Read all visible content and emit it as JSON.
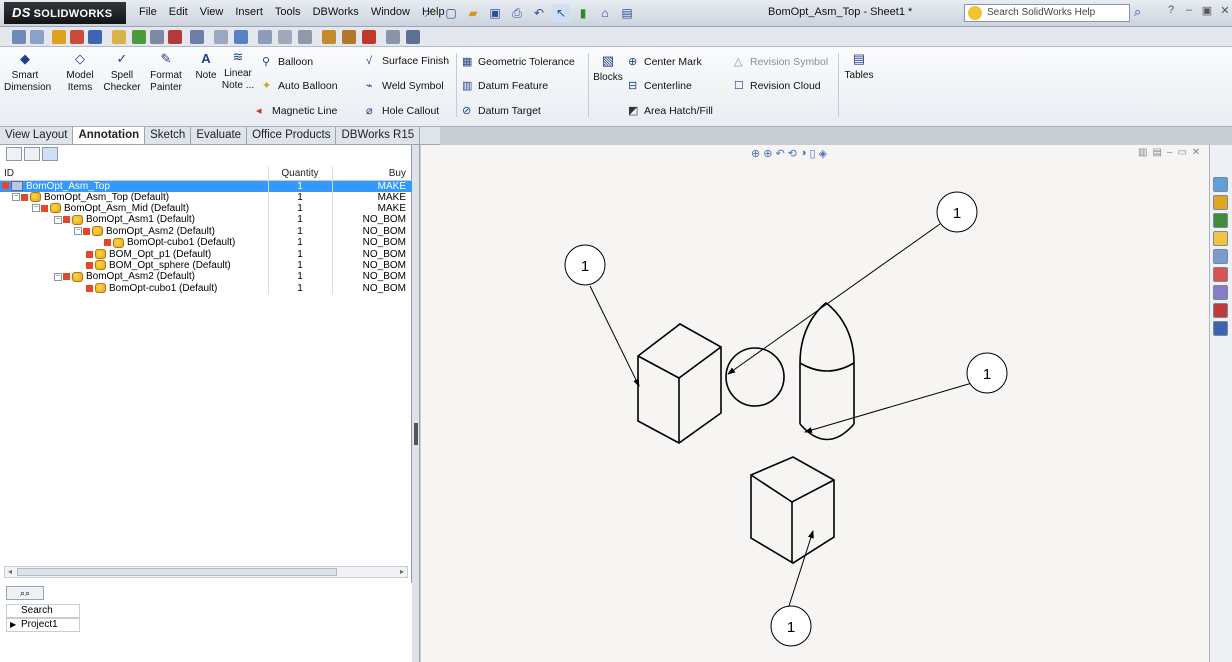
{
  "app": {
    "logo_text": "SOLIDWORKS",
    "logo_prefix": "DS",
    "document_title": "BomOpt_Asm_Top - Sheet1 *",
    "help_search_placeholder": "Search SolidWorks Help",
    "menus": [
      "File",
      "Edit",
      "View",
      "Insert",
      "Tools",
      "DBWorks",
      "Window",
      "Help"
    ]
  },
  "ribbon": {
    "smart_dimension": "Smart Dimension",
    "model_items": "Model Items",
    "spell_checker": "Spell Checker",
    "format_painter": "Format Painter",
    "note": "Note",
    "linear_note": "Linear Note ...",
    "balloon": "Balloon",
    "auto_balloon": "Auto Balloon",
    "magnetic_line": "Magnetic Line",
    "surface_finish": "Surface Finish",
    "weld_symbol": "Weld Symbol",
    "hole_callout": "Hole Callout",
    "geometric_tolerance": "Geometric Tolerance",
    "datum_feature": "Datum Feature",
    "datum_target": "Datum Target",
    "blocks": "Blocks",
    "center_mark": "Center Mark",
    "centerline": "Centerline",
    "area_hatch": "Area Hatch/Fill",
    "revision_symbol": "Revision Symbol",
    "revision_cloud": "Revision Cloud",
    "tables": "Tables"
  },
  "command_tabs": [
    "View Layout",
    "Annotation",
    "Sketch",
    "Evaluate",
    "Office Products",
    "DBWorks R15"
  ],
  "active_tab": "Annotation",
  "bom": {
    "headers": {
      "id": "ID",
      "quantity": "Quantity",
      "buy": "Buy"
    },
    "rows": [
      {
        "name": "BomOpt_Asm_Top",
        "quantity": "1",
        "buy": "MAKE"
      },
      {
        "name": "BomOpt_Asm_Top (Default)",
        "quantity": "1",
        "buy": "MAKE"
      },
      {
        "name": "BomOpt_Asm_Mid (Default)",
        "quantity": "1",
        "buy": "MAKE"
      },
      {
        "name": "BomOpt_Asm1 (Default)",
        "quantity": "1",
        "buy": "NO_BOM"
      },
      {
        "name": "BomOpt_Asm2 (Default)",
        "quantity": "1",
        "buy": "NO_BOM"
      },
      {
        "name": "BomOpt-cubo1 (Default)",
        "quantity": "1",
        "buy": "NO_BOM"
      },
      {
        "name": "BOM_Opt_p1 (Default)",
        "quantity": "1",
        "buy": "NO_BOM"
      },
      {
        "name": "BOM_Opt_sphere (Default)",
        "quantity": "1",
        "buy": "NO_BOM"
      },
      {
        "name": "BomOpt_Asm2 (Default)",
        "quantity": "1",
        "buy": "NO_BOM"
      },
      {
        "name": "BomOpt-cubo1 (Default)",
        "quantity": "1",
        "buy": "NO_BOM"
      }
    ]
  },
  "search_panel": {
    "search_label": "Search",
    "project": "Project1"
  },
  "drawing": {
    "balloons": [
      "1",
      "1",
      "1",
      "1"
    ]
  },
  "colors": {
    "selection": "#3399ff",
    "ribbon_icon": "#203f86",
    "sheet": "#f6f5f3"
  }
}
